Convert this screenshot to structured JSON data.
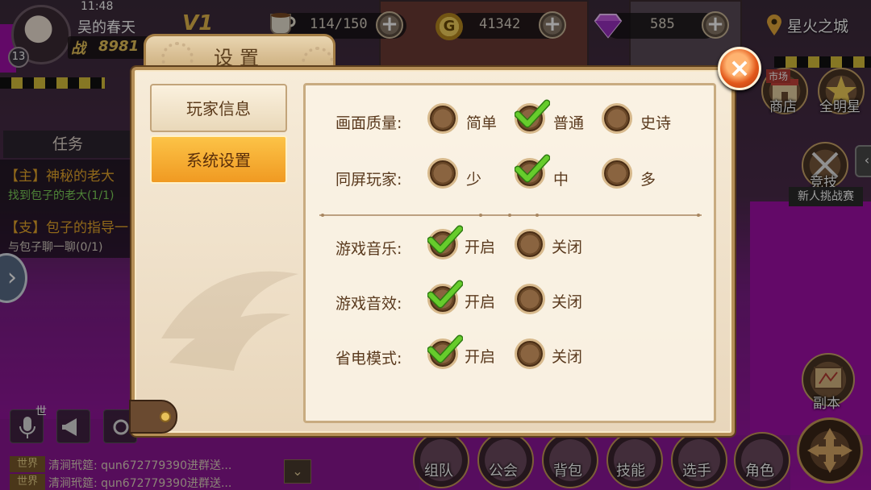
{
  "status": {
    "time": "11:48"
  },
  "player": {
    "name": "吴的春天",
    "level": "13",
    "power_label": "战",
    "power_value": "8981",
    "vip": "V1"
  },
  "resources": {
    "stamina": "114/150",
    "gold": "41342",
    "gold_symbol": "G",
    "gems": "585"
  },
  "location": "星火之城",
  "quest": {
    "title": "任务",
    "items": [
      {
        "name": "【主】神秘的老大",
        "desc": "找到包子的老大(1/1)"
      },
      {
        "name": "【支】包子的指导一",
        "desc": "与包子聊一聊(0/1)"
      }
    ]
  },
  "chat": {
    "channel": "世界",
    "mic_channel": "世",
    "messages": [
      {
        "tag": "世界",
        "user": "清涧玳筵:",
        "text": "qun672779390进群送..."
      },
      {
        "tag": "世界",
        "user": "清涧玳筵:",
        "text": "qun672779390进群送..."
      }
    ]
  },
  "right_menu": {
    "shop": "商店",
    "allstar": "全明星",
    "compete": "竞技",
    "challenge": "新人挑战赛",
    "dungeon": "副本",
    "shop_sign": "市场"
  },
  "bottom_menu": [
    "组队",
    "公会",
    "背包",
    "技能",
    "选手",
    "角色"
  ],
  "dialog": {
    "title": "设置",
    "tabs": [
      {
        "label": "玩家信息",
        "active": false
      },
      {
        "label": "系统设置",
        "active": true
      }
    ],
    "settings": {
      "quality": {
        "label": "画面质量:",
        "options": [
          "简单",
          "普通",
          "史诗"
        ],
        "selected": "普通"
      },
      "players": {
        "label": "同屏玩家:",
        "options": [
          "少",
          "中",
          "多"
        ],
        "selected": "中"
      },
      "music": {
        "label": "游戏音乐:",
        "options": [
          "开启",
          "关闭"
        ],
        "selected": "开启"
      },
      "sfx": {
        "label": "游戏音效:",
        "options": [
          "开启",
          "关闭"
        ],
        "selected": "开启"
      },
      "power_save": {
        "label": "省电模式:",
        "options": [
          "开启",
          "关闭"
        ],
        "selected": "开启"
      }
    }
  },
  "colors": {
    "accent_orange": "#f09a22",
    "check_green": "#5fc52a",
    "panel_brown": "#5a3a1e"
  }
}
